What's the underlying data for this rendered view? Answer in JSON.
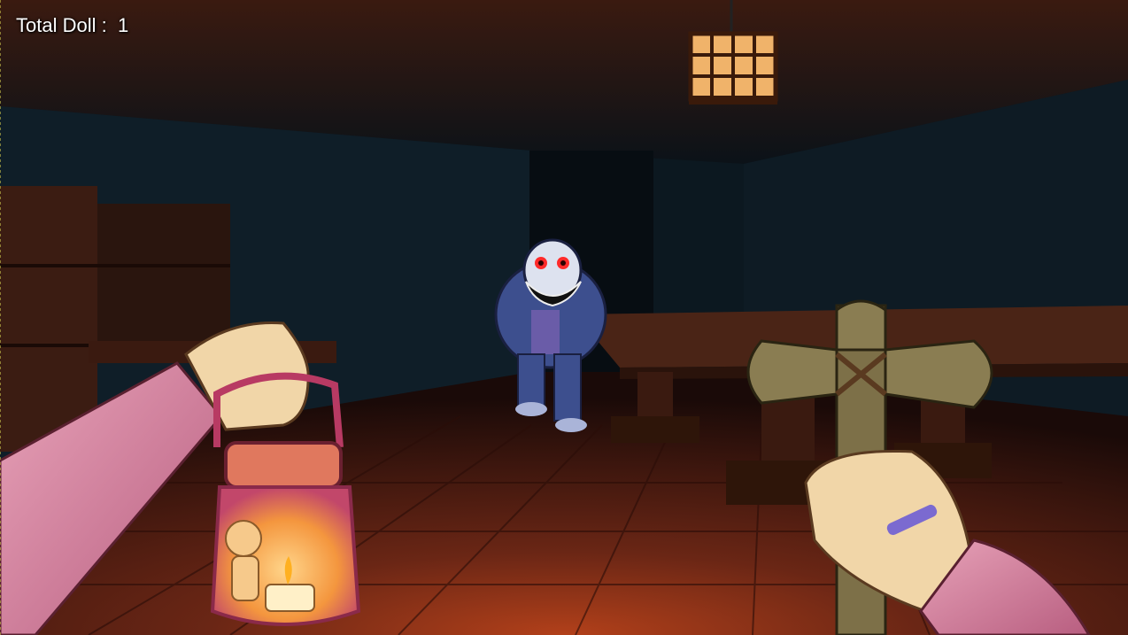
{
  "hud": {
    "doll_label": "Total Doll :",
    "doll_count": "1"
  },
  "colors": {
    "floor": "#5a2114",
    "wall": "#0f1c26",
    "monster_body": "#3d4f8e",
    "monster_eyes": "#ff2a2a",
    "lantern_glow": "#f4a24a",
    "sleeve": "#d98aa5",
    "cross_wood": "#7d7048"
  },
  "icons": {
    "lantern": "hanging-lantern-icon",
    "jar": "doll-jar-lantern-icon",
    "cross": "wooden-cross-icon"
  }
}
